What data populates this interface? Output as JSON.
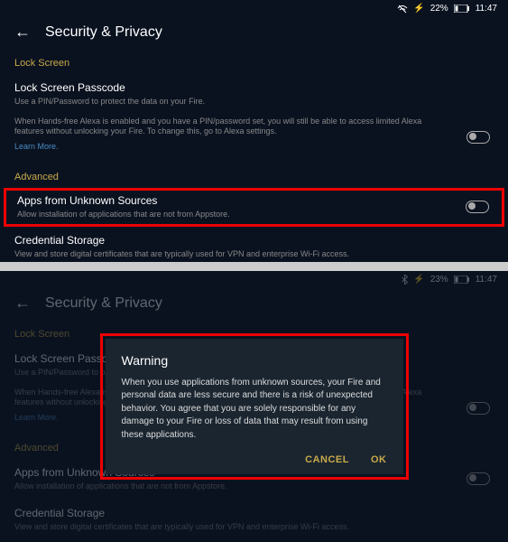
{
  "screen1": {
    "status": {
      "battery": "22%",
      "time": "11:47"
    },
    "title": "Security & Privacy",
    "sections": {
      "lockscreen": {
        "header": "Lock Screen",
        "passcode": {
          "title": "Lock Screen Passcode",
          "desc": "Use a PIN/Password to protect the data on your Fire."
        },
        "alexa_note": "When Hands-free Alexa is enabled and you have a PIN/password set, you will still be able to access limited Alexa features without unlocking your Fire. To change this, go to Alexa settings.",
        "learn_more": "Learn More."
      },
      "advanced": {
        "header": "Advanced",
        "unknown_sources": {
          "title": "Apps from Unknown Sources",
          "desc": "Allow installation of applications that are not from Appstore."
        },
        "credential": {
          "title": "Credential Storage",
          "desc": "View and store digital certificates that are typically used for VPN and enterprise Wi-Fi access."
        }
      }
    }
  },
  "screen2": {
    "status": {
      "battery": "23%",
      "time": "11:47"
    },
    "title": "Security & Privacy",
    "dialog": {
      "title": "Warning",
      "body": "When you use applications from unknown sources, your Fire and personal data are less secure and there is a risk of unexpected behavior. You agree that you are solely responsible for any damage to your Fire or loss of data that may result from using these applications.",
      "cancel": "CANCEL",
      "ok": "OK"
    },
    "bg": {
      "lockscreen_header": "Lock Screen",
      "passcode_title": "Lock Screen Passcode",
      "passcode_desc": "Use a PIN/Password to protect the data on your Fire.",
      "alexa_note": "When Hands-free Alexa is enabled and you have a PIN/password set, you will still be able to access limited Alexa features without unlocking your Fire. To change this, go to Alexa settings.",
      "learn_more": "Learn More.",
      "advanced_header": "Advanced",
      "unknown_title": "Apps from Unknown Sources",
      "unknown_desc": "Allow installation of applications that are not from Appstore.",
      "credential_title": "Credential Storage",
      "credential_desc": "View and store digital certificates that are typically used for VPN and enterprise Wi-Fi access."
    }
  }
}
